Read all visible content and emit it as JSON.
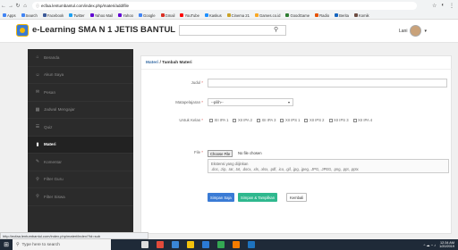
{
  "browser": {
    "url": "ecfaa.lentumbantul.com/index.php/materi/add/file",
    "bookmarks": [
      {
        "label": "Apps",
        "color": "#4285f4"
      },
      {
        "label": "Search",
        "color": "#4285f4"
      },
      {
        "label": "Facebook",
        "color": "#3b5998"
      },
      {
        "label": "Twitter",
        "color": "#1da1f2"
      },
      {
        "label": "Yahoo Mail",
        "color": "#6001d2"
      },
      {
        "label": "Yahoo",
        "color": "#6001d2"
      },
      {
        "label": "Google",
        "color": "#4285f4"
      },
      {
        "label": "Gmail",
        "color": "#d93025"
      },
      {
        "label": "YouTube",
        "color": "#ff0000"
      },
      {
        "label": "Kaskus",
        "color": "#1e90ff"
      },
      {
        "label": "Cinema 21",
        "color": "#c9a227"
      },
      {
        "label": "Games.co.id",
        "color": "#f9a825"
      },
      {
        "label": "GoodGame",
        "color": "#2e7d32"
      },
      {
        "label": "Radio",
        "color": "#e65100"
      },
      {
        "label": "Berita",
        "color": "#1565c0"
      },
      {
        "label": "Komik",
        "color": "#6d4c41"
      }
    ]
  },
  "header": {
    "title": "e-Learning SMA N 1 JETIS BANTUL",
    "user_name": "Lani"
  },
  "sidebar": {
    "items": [
      {
        "label": "Beranda",
        "icon": "home-icon",
        "glyph": "⌂",
        "active": false
      },
      {
        "label": "Akun Saya",
        "icon": "user-icon",
        "glyph": "☺",
        "active": false
      },
      {
        "label": "Pesan",
        "icon": "envelope-icon",
        "glyph": "✉",
        "active": false
      },
      {
        "label": "Jadwal Mengajar",
        "icon": "calendar-icon",
        "glyph": "▦",
        "active": false
      },
      {
        "label": "Quiz",
        "icon": "quiz-icon",
        "glyph": "☰",
        "active": false
      },
      {
        "label": "Materi",
        "icon": "book-icon",
        "glyph": "▮",
        "active": true
      },
      {
        "label": "Komentar",
        "icon": "comment-icon",
        "glyph": "✎",
        "active": false
      },
      {
        "label": "Filter Guru",
        "icon": "filter-icon",
        "glyph": "⚲",
        "active": false
      },
      {
        "label": "Filter Siswa",
        "icon": "filter-icon",
        "glyph": "⚲",
        "active": false
      }
    ]
  },
  "form": {
    "breadcrumb_link": "Materi",
    "breadcrumb_sep": " / ",
    "breadcrumb_current": "Tambah Materi",
    "judul_label": "Judul",
    "mapel_label": "Matapelajaran",
    "mapel_value": "--pilih--",
    "kelas_label": "Untuk Kelas",
    "kelas_options": [
      "XII IPA 1",
      "XII IPA 2",
      "XII IPA 3",
      "XII IPS 1",
      "XII IPS 2",
      "XII IPS 3",
      "XII IPA 4"
    ],
    "file_label": "File",
    "file_button": "Choose File",
    "file_status": "No file chosen",
    "file_hint_1": "Ekstensi yang diijinkan",
    "file_hint_2": ".doc, .zip, .rar, .txt, .docx, .xls, .xlsx, .pdf, .ico, .gif, .jpg, .jpeg, .JPG, .JPEG, .png, .ppt, .pptx",
    "btn_save": "Simpan Saja",
    "btn_save_publish": "Simpan & Tampilkan",
    "btn_back": "Kembali",
    "required_mark": " *"
  },
  "status_url": "http://ecfaa.lentumbantul.com/index.php/materi/index/?id=sub",
  "taskbar": {
    "search_placeholder": "Type here to search",
    "time": "12:34 AM",
    "date": "1/20/2019"
  }
}
